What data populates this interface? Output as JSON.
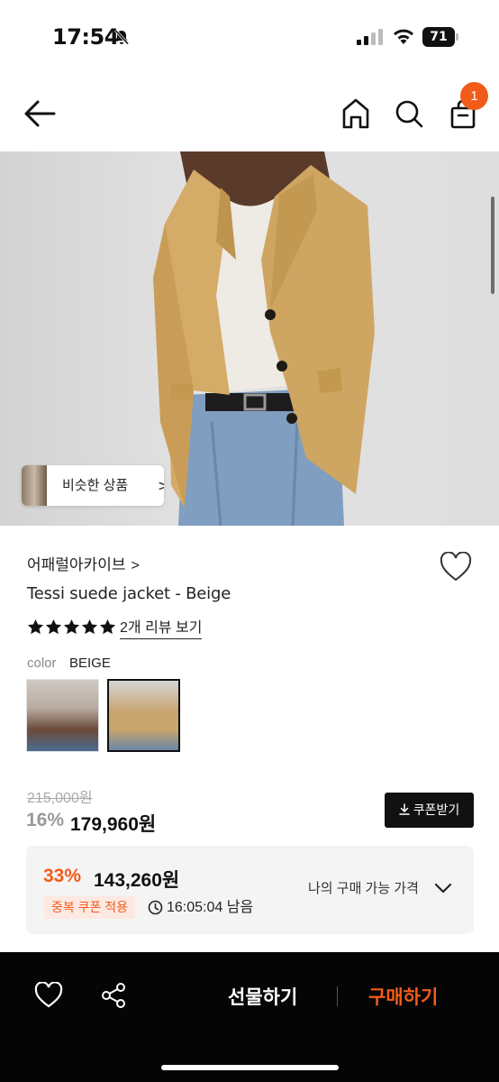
{
  "status_bar": {
    "time": "17:54",
    "battery": "71"
  },
  "nav": {
    "cart_count": "1"
  },
  "hero": {
    "similar_label": "비슷한 상품",
    "similar_chevron": ">"
  },
  "product": {
    "brand": "어패럴아카이브",
    "brand_chevron": ">",
    "title": "Tessi suede jacket - Beige",
    "rating_stars": 5,
    "review_link": "2개 리뷰 보기",
    "color_label": "color",
    "color_value": "BEIGE"
  },
  "price": {
    "original": "215,000원",
    "discount": "16%",
    "sale": "179,960원",
    "coupon_button": "쿠폰받기"
  },
  "best_price": {
    "discount": "33%",
    "price": "143,260원",
    "coupon_tag": "중복 쿠폰 적용",
    "timer": "16:05:04 남음",
    "my_price_label": "나의 구매 가능 가격"
  },
  "bottom_bar": {
    "gift_label": "선물하기",
    "buy_label": "구매하기"
  },
  "colors": {
    "accent": "#f25c19",
    "dark": "#111111"
  }
}
